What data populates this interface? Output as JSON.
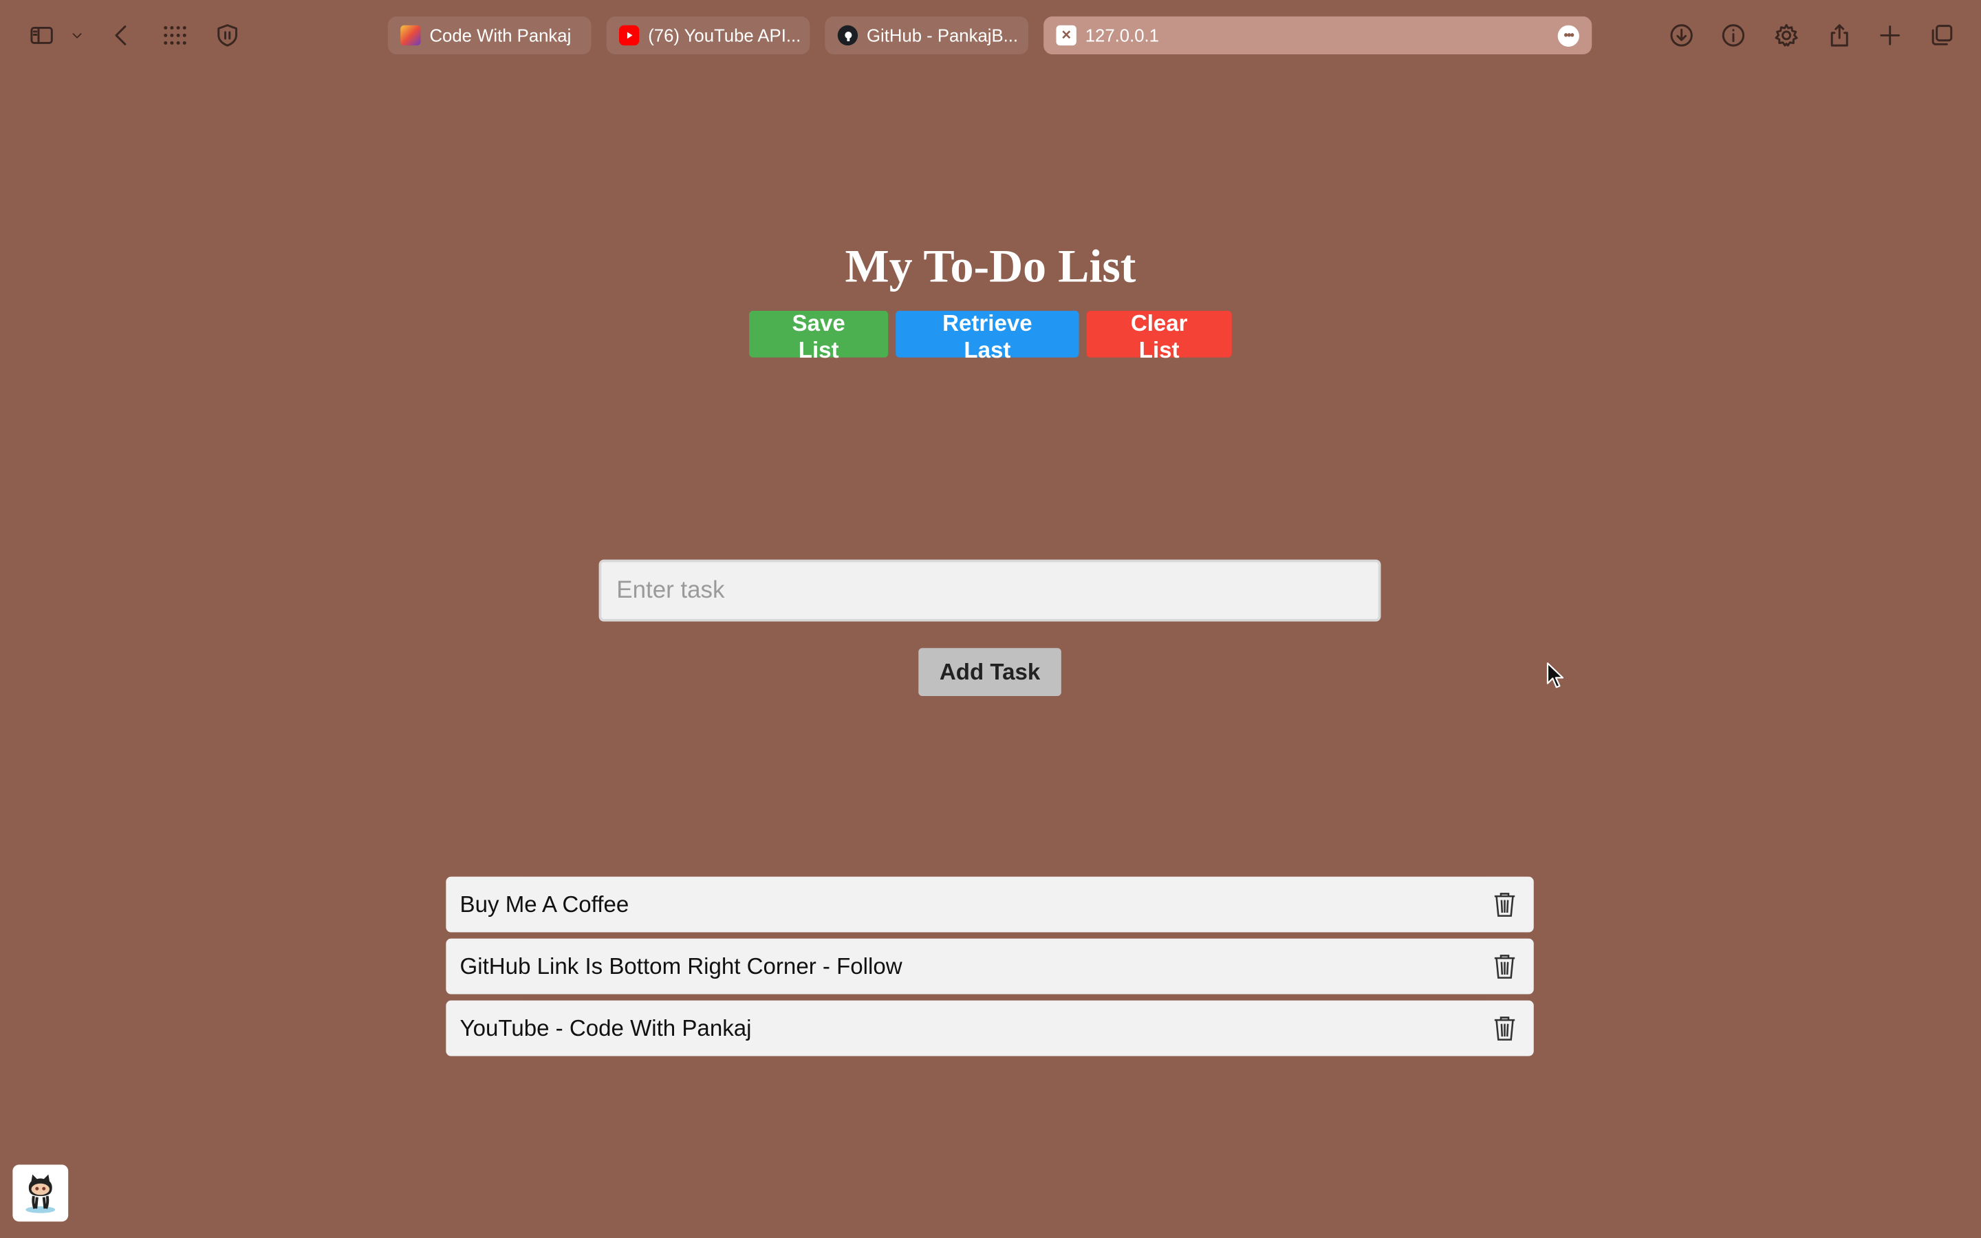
{
  "browser": {
    "tabs": [
      {
        "label": "Code With Pankaj",
        "favicon": "code-with-pankaj-favicon"
      },
      {
        "label": "(76) YouTube API...",
        "favicon": "youtube-favicon"
      },
      {
        "label": "GitHub - PankajB...",
        "favicon": "github-favicon"
      }
    ],
    "address": "127.0.0.1",
    "toolbar_icons": [
      "sidebar-icon",
      "chevron-down-icon",
      "back-icon",
      "grid-icon",
      "shield-icon",
      "download-icon",
      "info-icon",
      "gear-icon",
      "share-icon",
      "plus-icon",
      "tabs-overview-icon"
    ]
  },
  "page": {
    "title": "My To-Do List",
    "buttons": {
      "save": "Save List",
      "retrieve": "Retrieve Last",
      "clear": "Clear List"
    },
    "input_placeholder": "Enter task",
    "input_value": "",
    "add_button": "Add Task",
    "tasks": [
      "Buy Me A Coffee",
      "GitHub Link Is Bottom Right Corner - Follow",
      "YouTube - Code With Pankaj"
    ]
  },
  "colors": {
    "background": "#8e5e4e",
    "save": "#4caf50",
    "retrieve": "#2196f3",
    "clear": "#f44336"
  }
}
